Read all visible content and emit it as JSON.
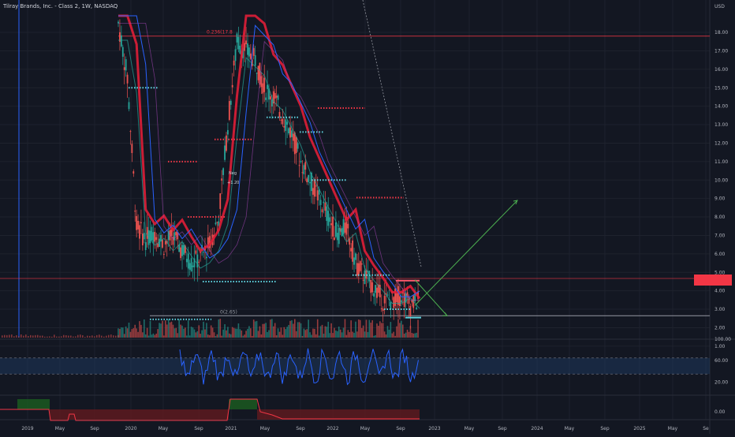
{
  "title": "Tilray Brands, Inc. - Class 2, 1W, NASDAQ",
  "currency": "USD",
  "price_ticks": [
    "18.00",
    "17.00",
    "16.00",
    "15.00",
    "14.00",
    "13.00",
    "12.00",
    "11.00",
    "10.00",
    "9.00",
    "8.00",
    "7.00",
    "6.00",
    "5.00",
    "4.00",
    "3.00",
    "2.00",
    "1.00"
  ],
  "osc_ticks": [
    "100.00",
    "60.00",
    "20.00"
  ],
  "bottom_ticks": [
    "0.00"
  ],
  "time_labels": [
    "2019",
    "May",
    "Sep",
    "2020",
    "May",
    "Sep",
    "2021",
    "May",
    "Sep",
    "2022",
    "May",
    "Sep",
    "2023",
    "May",
    "Sep",
    "2024",
    "May",
    "Sep",
    "2025",
    "May",
    "Se"
  ],
  "current_price_label": "",
  "annotations": {
    "fib_top": "0.236(17.8",
    "fib_bottom": "0(2.65)",
    "neg_label": "Neg",
    "neg_value": "+1.20"
  },
  "colors": {
    "background": "#131722",
    "up": "#26a69a",
    "down": "#ef5350",
    "red_line": "#f23645",
    "blue_line": "#2962ff",
    "green_arrow": "#4caf50",
    "osc_line": "#2962ff",
    "osc_band": "#1e3a5f"
  },
  "chart_data": {
    "type": "line",
    "title": "Tilray Brands, Inc. - Class 2, 1W, NASDAQ",
    "ylabel": "USD",
    "ylim": [
      0.2,
      18.9
    ],
    "x": [
      "2020-01",
      "2020-02",
      "2020-03",
      "2020-04",
      "2020-05",
      "2020-06",
      "2020-07",
      "2020-08",
      "2020-09",
      "2020-10",
      "2020-11",
      "2020-12",
      "2021-01",
      "2021-02",
      "2021-03",
      "2021-04",
      "2021-05",
      "2021-06",
      "2021-07",
      "2021-08",
      "2021-09",
      "2021-10",
      "2021-11",
      "2021-12",
      "2022-01",
      "2022-02",
      "2022-03",
      "2022-04",
      "2022-05",
      "2022-06",
      "2022-07",
      "2022-08",
      "2022-09",
      "2022-10"
    ],
    "series": [
      {
        "name": "",
        "values": [
          18.5,
          15.5,
          7.5,
          6.8,
          7.2,
          6.5,
          7.0,
          6.2,
          5.5,
          5.8,
          6.5,
          8.0,
          13.0,
          17.5,
          17.0,
          16.5,
          15.0,
          14.5,
          13.5,
          12.5,
          11.0,
          10.0,
          9.0,
          8.0,
          7.0,
          7.5,
          5.5,
          4.8,
          4.2,
          3.5,
          3.5,
          3.8,
          3.2,
          3.6
        ]
      }
    ],
    "levels": {
      "fib_0_236": 17.8,
      "fib_0": 2.65
    },
    "projection": {
      "from": 3.2,
      "to": 8.9
    },
    "oscillator": {
      "ylim": [
        0,
        100
      ],
      "band": [
        35,
        65
      ]
    }
  }
}
